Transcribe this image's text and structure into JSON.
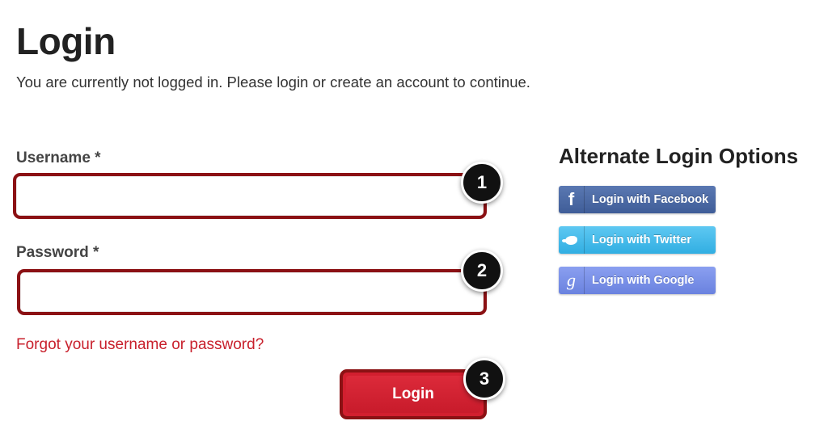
{
  "page": {
    "title": "Login",
    "subtitle": "You are currently not logged in. Please login or create an account to continue."
  },
  "form": {
    "username": {
      "label": "Username *",
      "value": "",
      "placeholder": ""
    },
    "password": {
      "label": "Password *",
      "value": "",
      "placeholder": ""
    },
    "forgot_link": "Forgot your username or password?",
    "login_button": "Login"
  },
  "steps": [
    "1",
    "2",
    "3"
  ],
  "alternate": {
    "title": "Alternate Login Options",
    "buttons": [
      {
        "label": "Login with Facebook",
        "icon": "facebook-icon",
        "glyph": "f",
        "color": "#4a68a6"
      },
      {
        "label": "Login with Twitter",
        "icon": "twitter-icon",
        "glyph": "",
        "color": "#3fb9ea"
      },
      {
        "label": "Login with Google",
        "icon": "google-icon",
        "glyph": "g",
        "color": "#7890e8"
      }
    ]
  },
  "colors": {
    "accent_red": "#d21f2f",
    "highlight_border": "#8b1114",
    "link_red": "#c8202c"
  }
}
